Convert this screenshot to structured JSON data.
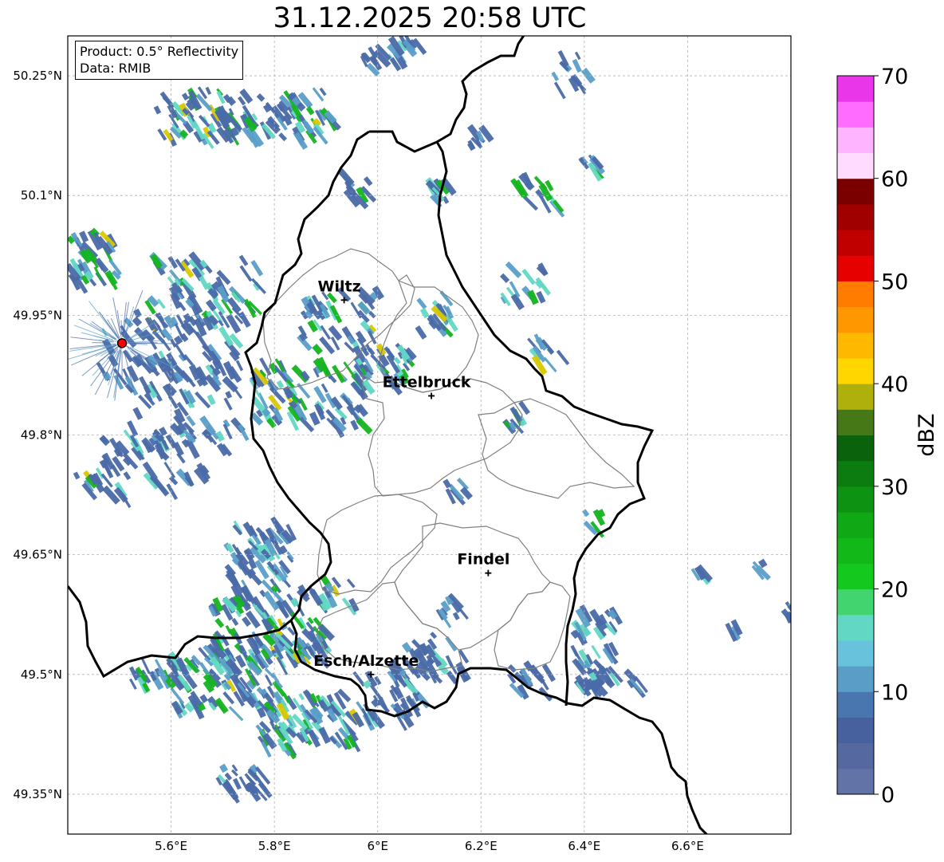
{
  "title": "31.12.2025 20:58 UTC",
  "info": {
    "product": "Product: 0.5° Reflectivity",
    "data": "Data: RMIB"
  },
  "axes": {
    "lon_ticks": [
      {
        "value": 5.6,
        "label": "5.6°E"
      },
      {
        "value": 5.8,
        "label": "5.8°E"
      },
      {
        "value": 6.0,
        "label": "6°E"
      },
      {
        "value": 6.2,
        "label": "6.2°E"
      },
      {
        "value": 6.4,
        "label": "6.4°E"
      },
      {
        "value": 6.6,
        "label": "6.6°E"
      }
    ],
    "lat_ticks": [
      {
        "value": 50.25,
        "label": "50.25°N"
      },
      {
        "value": 50.1,
        "label": "50.1°N"
      },
      {
        "value": 49.95,
        "label": "49.95°N"
      },
      {
        "value": 49.8,
        "label": "49.8°N"
      },
      {
        "value": 49.65,
        "label": "49.65°N"
      },
      {
        "value": 49.5,
        "label": "49.5°N"
      },
      {
        "value": 49.35,
        "label": "49.35°N"
      }
    ],
    "lon_range": [
      5.4,
      6.8
    ],
    "lat_range": [
      49.3,
      50.3
    ],
    "grid": true
  },
  "cities": [
    {
      "name": "Wiltz",
      "lon": 5.935,
      "lat": 49.969
    },
    {
      "name": "Ettelbruck",
      "lon": 6.104,
      "lat": 49.849
    },
    {
      "name": "Findel",
      "lon": 6.214,
      "lat": 49.627
    },
    {
      "name": "Esch/Alzette",
      "lon": 5.987,
      "lat": 49.5
    }
  ],
  "radar_site": {
    "lon": 5.505,
    "lat": 49.915,
    "color": "#ff0000"
  },
  "colorbar": {
    "label": "dBZ",
    "min": 0,
    "max": 70,
    "tick_values": [
      0,
      10,
      20,
      30,
      40,
      50,
      60,
      70
    ],
    "tick_labels": [
      "0",
      "10",
      "20",
      "30",
      "40",
      "50",
      "60",
      "70"
    ],
    "colors": [
      "#6273a8",
      "#5569a0",
      "#46619e",
      "#4a76b0",
      "#5a9ec8",
      "#68c2dc",
      "#62d8c4",
      "#42d46e",
      "#14c81e",
      "#12b818",
      "#10a814",
      "#0e9212",
      "#0c7c10",
      "#0a620c",
      "#467818",
      "#b0b00c",
      "#ffd600",
      "#ffb800",
      "#ff9800",
      "#ff7c00",
      "#e60000",
      "#c00000",
      "#a00000",
      "#7a0000",
      "#ffdcff",
      "#ffb4ff",
      "#ff6cff",
      "#e836e8"
    ]
  },
  "echo_colors": {
    "light": "#4a6aa8",
    "mid": "#5a9ec8",
    "cyan": "#62d8c4",
    "green": "#14b420",
    "yellow": "#d8c800"
  }
}
